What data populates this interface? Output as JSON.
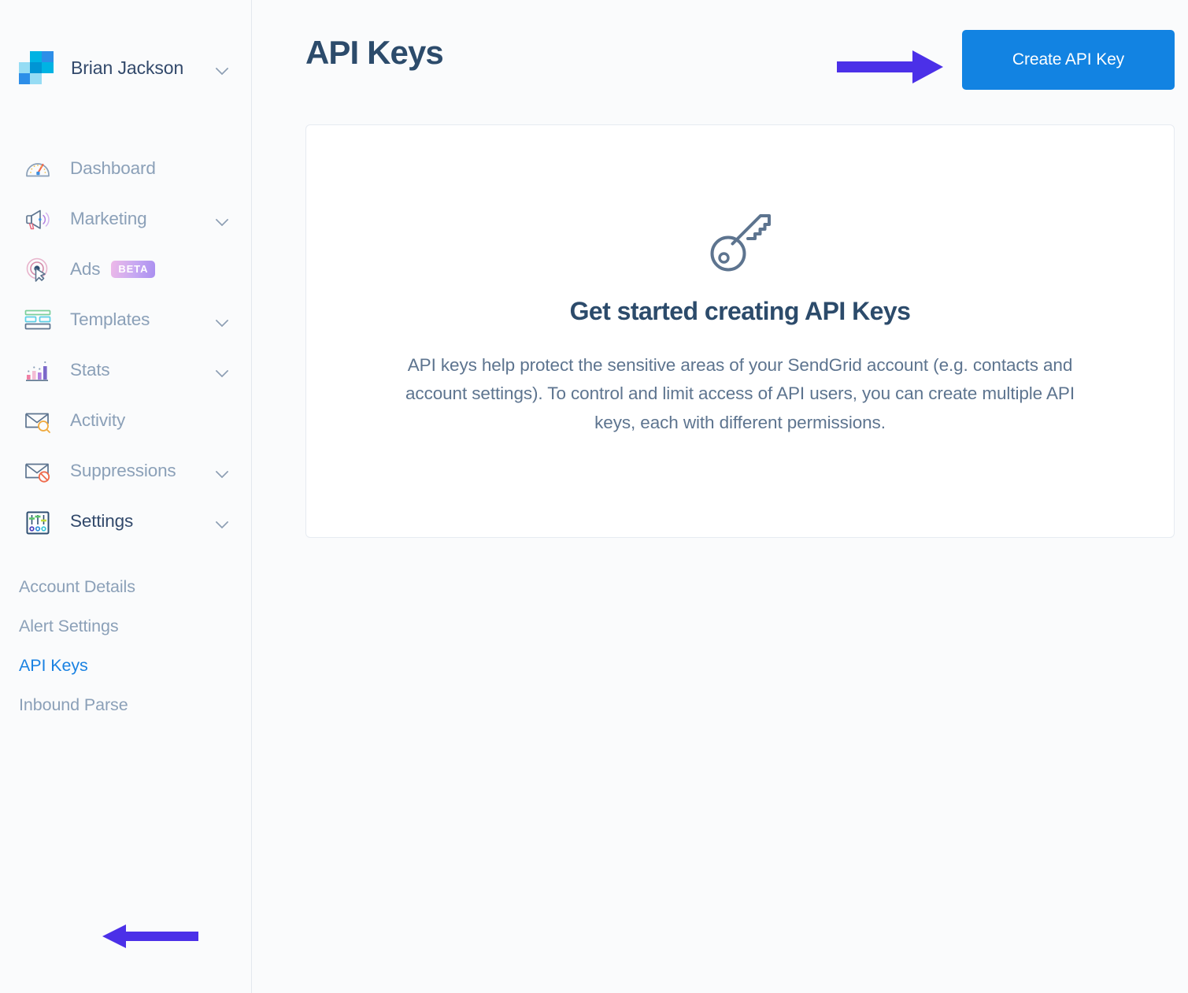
{
  "colors": {
    "accent_blue": "#1283e2",
    "link_blue": "#1a82e2",
    "annotation_purple": "#4b30e8",
    "heading_navy": "#2c4b6b",
    "muted_text": "#8ba0b8",
    "body_text": "#5d748f",
    "sidebar_bg": "#fafbfc",
    "card_border": "#e6ebf1"
  },
  "sidebar": {
    "account": {
      "name": "Brian Jackson",
      "logo_icon": "sendgrid-logo-icon",
      "chevron_icon": "chevron-down-icon"
    },
    "items": [
      {
        "label": "Dashboard",
        "icon": "gauge-icon",
        "chevron": false,
        "badge": null
      },
      {
        "label": "Marketing",
        "icon": "megaphone-icon",
        "chevron": true,
        "badge": null
      },
      {
        "label": "Ads",
        "icon": "ad-target-icon",
        "chevron": false,
        "badge": "BETA"
      },
      {
        "label": "Templates",
        "icon": "template-icon",
        "chevron": true,
        "badge": null
      },
      {
        "label": "Stats",
        "icon": "bar-chart-icon",
        "chevron": true,
        "badge": null
      },
      {
        "label": "Activity",
        "icon": "envelope-search-icon",
        "chevron": false,
        "badge": null
      },
      {
        "label": "Suppressions",
        "icon": "envelope-block-icon",
        "chevron": true,
        "badge": null
      },
      {
        "label": "Settings",
        "icon": "sliders-icon",
        "chevron": true,
        "badge": null,
        "expanded": true
      }
    ],
    "subitems": [
      {
        "label": "Account Details",
        "current": false
      },
      {
        "label": "Alert Settings",
        "current": false
      },
      {
        "label": "API Keys",
        "current": true
      },
      {
        "label": "Inbound Parse",
        "current": false
      }
    ]
  },
  "main": {
    "page_title": "API Keys",
    "create_button_label": "Create API Key",
    "empty_state": {
      "icon": "key-icon",
      "title": "Get started creating API Keys",
      "body": "API keys help protect the sensitive areas of your SendGrid account (e.g. contacts and account settings). To control and limit access of API users, you can create multiple API keys, each with different permissions."
    }
  },
  "annotations": [
    {
      "name": "arrow-to-create-button",
      "direction": "right",
      "color": "#4b30e8"
    },
    {
      "name": "arrow-to-api-keys-link",
      "direction": "left",
      "color": "#4b30e8"
    }
  ]
}
